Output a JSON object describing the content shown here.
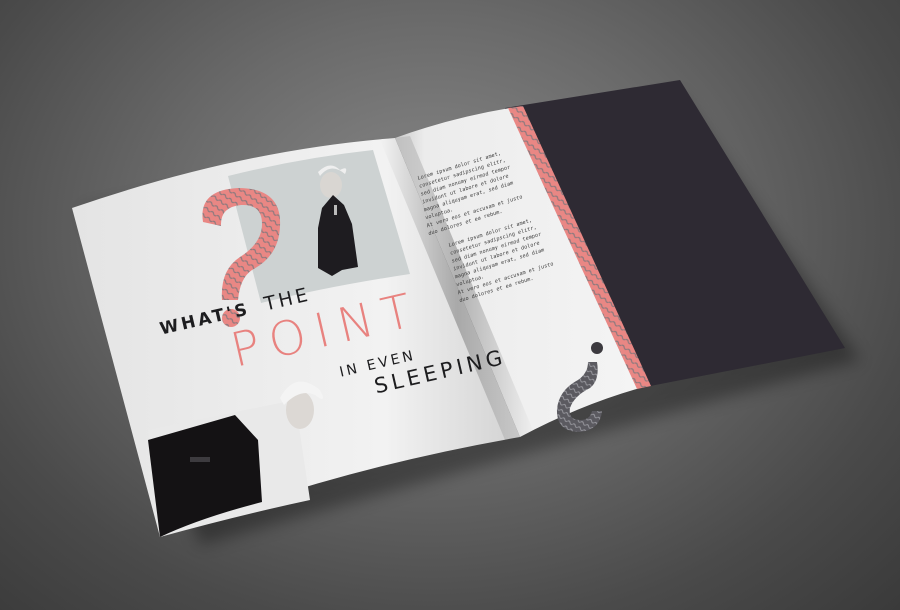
{
  "headline": {
    "line1": "WHAT'S",
    "line2": "THE",
    "line3": "POINT",
    "line4": "IN EVEN",
    "line5": "SLEEPING"
  },
  "body_paragraphs": [
    "Lorem ipsum dolor sit amet,\nconsetetur sadipscing elitr,\nsed diam nonumy eirmod tempor\ninvidunt ut labore et dolore\nmagna aliquyam erat, sed diam\nvoluptua.\nAt vero eos et accusam et justo\nduo dolores et ea rebum.",
    "Lorem ipsum dolor sit amet,\nconsetetur sadipscing elitr,\nsed diam nonumy eirmod tempor\ninvidunt ut labore et dolore\nmagna aliquyam erat, sed diam\nvoluptua.\nAt vero eos et accusam et justo\nduo dolores et ea rebum."
  ],
  "colors": {
    "accent_pink": "#e8827f",
    "dark_panel": "#2e2a33",
    "paper": "#f1f1f1",
    "text_dark": "#1d1d1f"
  },
  "icons": [
    "question-mark-glyph",
    "inverted-question-mark-glyph"
  ]
}
